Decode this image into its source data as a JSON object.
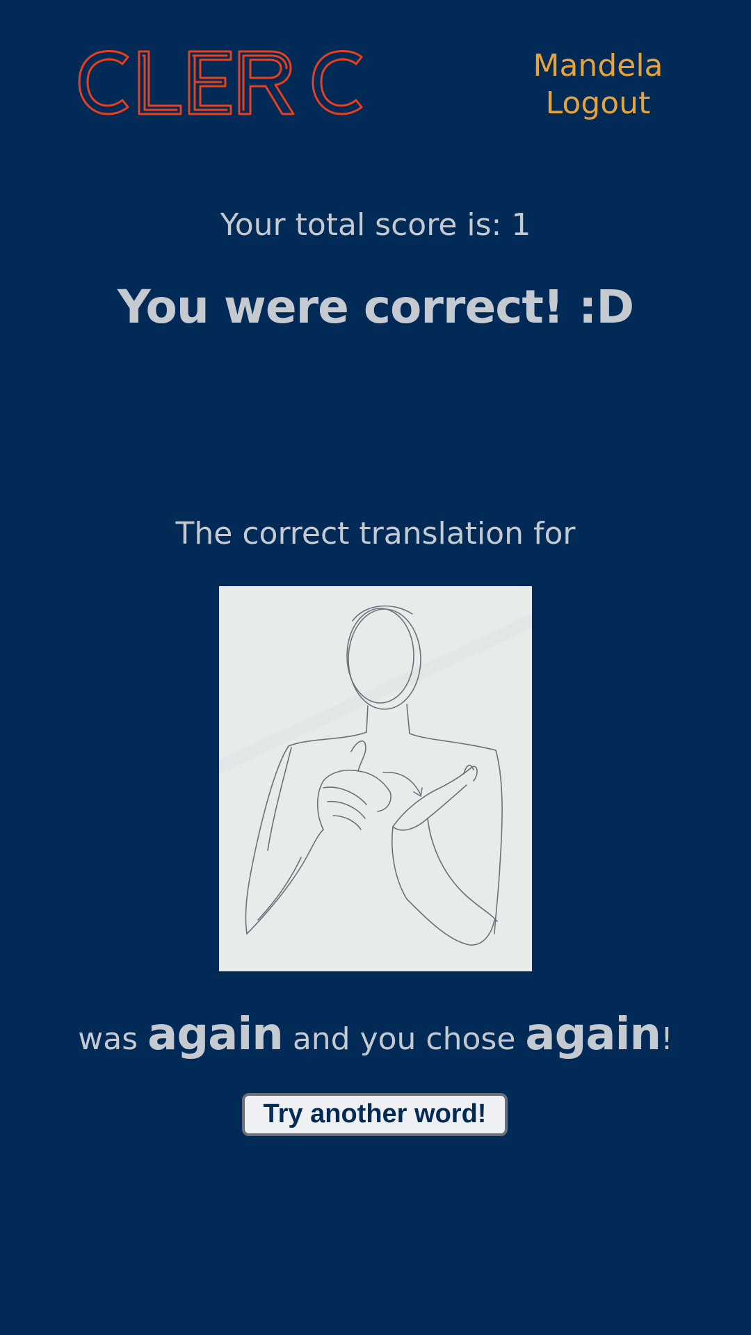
{
  "header": {
    "logo_text": "CLERC",
    "brand_color": "#e8401c",
    "username": "Mandela",
    "logout_label": "Logout",
    "nav_color": "#e6a33b"
  },
  "score": {
    "label": "Your total score is: 1"
  },
  "result": {
    "message": "You were correct! :D"
  },
  "question": {
    "prompt": "The correct translation for",
    "image_description_icon": "sign-drawing-image"
  },
  "answer": {
    "prefix": "was",
    "correct_word": "again",
    "middle": "and you chose",
    "chosen_word": "again",
    "suffix": "!"
  },
  "actions": {
    "try_another_label": "Try another word!"
  },
  "colors": {
    "background": "#022a56",
    "text": "#c5c9d0",
    "button_bg": "#eef0f4"
  }
}
